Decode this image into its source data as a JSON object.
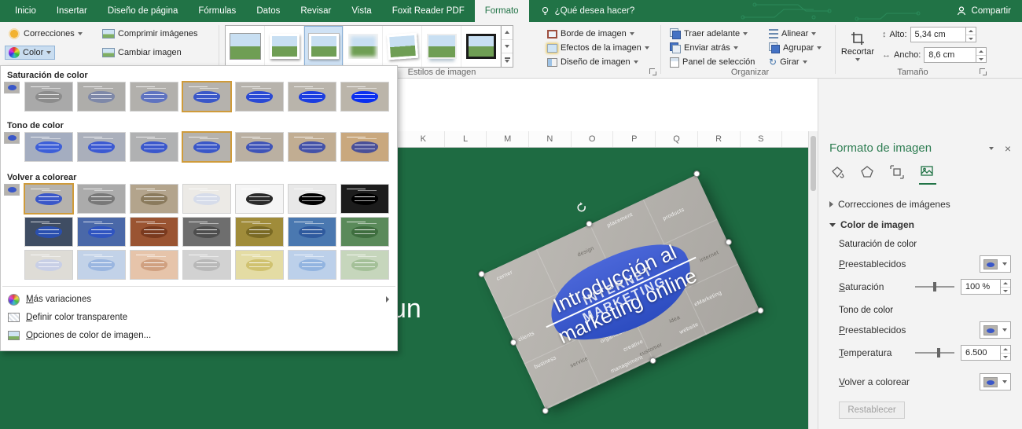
{
  "colors": {
    "excel_green": "#217346",
    "canvas_green": "#1e6b42",
    "pane_title": "#2e7d52",
    "picture_base": "#b5b2ad",
    "picture_accent": "#3a57c8",
    "selected_outline": "#cf9b3a",
    "gallery_sel_bg": "#cfe2f5",
    "gallery_sel_border": "#88b0d8"
  },
  "titlebar": {
    "tabs": [
      {
        "label": "Inicio"
      },
      {
        "label": "Insertar"
      },
      {
        "label": "Diseño de página"
      },
      {
        "label": "Fórmulas"
      },
      {
        "label": "Datos"
      },
      {
        "label": "Revisar"
      },
      {
        "label": "Vista"
      },
      {
        "label": "Foxit Reader PDF"
      },
      {
        "label": "Formato",
        "active": true
      }
    ],
    "search_label": "¿Qué desea hacer?",
    "share_label": "Compartir"
  },
  "ribbon": {
    "adjust": {
      "corrections_label": "Correcciones",
      "color_label": "Color",
      "compress_label": "Comprimir imágenes",
      "change_label": "Cambiar imagen"
    },
    "picture_styles": {
      "group_label": "Estilos de imagen",
      "items": [
        "marco-simple",
        "biselado-blanco",
        "rectangulo-sombreado",
        "bordes-suaves",
        "rectangulo-girado-blanco",
        "rectangulo-reflejado",
        "marco-negro"
      ],
      "selected_index": 2,
      "border_label": "Borde de imagen",
      "effects_label": "Efectos de la imagen",
      "layout_label": "Diseño de imagen"
    },
    "arrange": {
      "group_label": "Organizar",
      "bring_forward": "Traer adelante",
      "send_backward": "Enviar atrás",
      "selection_pane": "Panel de selección",
      "align": "Alinear",
      "group": "Agrupar",
      "rotate": "Girar"
    },
    "size": {
      "group_label": "Tamaño",
      "crop_label": "Recortar",
      "height_label": "Alto:",
      "height_value": "5,34 cm",
      "width_label": "Ancho:",
      "width_value": "8,6 cm"
    }
  },
  "color_menu": {
    "sections": {
      "saturation_title": "Saturación de color",
      "tone_title": "Tono de color",
      "recolor_title": "Volver a colorear"
    },
    "items": {
      "more_variations": "Más variaciones",
      "set_transparent": "Definir color transparente",
      "options": "Opciones de color de imagen..."
    },
    "saturation": [
      {
        "bg": "#a9a9a9",
        "accent": "#8c8c8c"
      },
      {
        "bg": "#aeadaa",
        "accent": "#7e88a8"
      },
      {
        "bg": "#b2b0ac",
        "accent": "#5f73c0"
      },
      {
        "bg": "#b5b2ad",
        "accent": "#3a57c8",
        "selected": true
      },
      {
        "bg": "#b7b3ac",
        "accent": "#2a49d4"
      },
      {
        "bg": "#b9b4ab",
        "accent": "#1b3de0"
      },
      {
        "bg": "#bbb5aa",
        "accent": "#0a2ff0"
      }
    ],
    "tone": [
      {
        "bg": "#a4adc0",
        "accent": "#3d5fd8"
      },
      {
        "bg": "#aaafbb",
        "accent": "#3c5ad2"
      },
      {
        "bg": "#b0b1b2",
        "accent": "#3b58cc"
      },
      {
        "bg": "#b5b2ad",
        "accent": "#3a57c8",
        "selected": true
      },
      {
        "bg": "#bab0a2",
        "accent": "#3f54b8"
      },
      {
        "bg": "#c1ad92",
        "accent": "#4452a8"
      },
      {
        "bg": "#c9a87e",
        "accent": "#4a5098"
      }
    ],
    "recolor": [
      [
        {
          "bg": "#b5b2ad",
          "accent": "#3a57c8",
          "selected": true
        },
        {
          "bg": "#ababab",
          "accent": "#787878"
        },
        {
          "bg": "#b3a48c",
          "accent": "#8a7a5c"
        },
        {
          "bg": "#eceae6",
          "accent": "#d6dcea"
        },
        {
          "bg": "#f5f5f5",
          "accent": "#2a2a2a"
        },
        {
          "bg": "#e8e8e8",
          "accent": "#000000"
        },
        {
          "bg": "#1c1c1c",
          "accent": "#000000"
        }
      ],
      [
        {
          "bg": "#3f4d63",
          "accent": "#2a4fae"
        },
        {
          "bg": "#4a68a8",
          "accent": "#2f54c0"
        },
        {
          "bg": "#9a5432",
          "accent": "#7a3a1e"
        },
        {
          "bg": "#6e6e6e",
          "accent": "#4e4e4e"
        },
        {
          "bg": "#a08c3a",
          "accent": "#7a6a24"
        },
        {
          "bg": "#4a78b0",
          "accent": "#2f5a9e"
        },
        {
          "bg": "#5a8a5a",
          "accent": "#3f6e3f"
        }
      ],
      [
        {
          "bg": "#dedcd6",
          "accent": "#c8cfe6"
        },
        {
          "bg": "#c2d2e8",
          "accent": "#9ab6e0"
        },
        {
          "bg": "#e6c4aa",
          "accent": "#d0a080"
        },
        {
          "bg": "#d2d2d2",
          "accent": "#b8b8b8"
        },
        {
          "bg": "#e4dca4",
          "accent": "#d0c270"
        },
        {
          "bg": "#bcd0ea",
          "accent": "#92b4e0"
        },
        {
          "bg": "#c6d6bc",
          "accent": "#a4c098"
        }
      ]
    ]
  },
  "sheet": {
    "columns": [
      "K",
      "L",
      "M",
      "N",
      "O",
      "P",
      "Q",
      "R",
      "S"
    ]
  },
  "canvas": {
    "fragment": "un",
    "image": {
      "title_line1": "Introducción al",
      "title_line2": "marketing online",
      "bg_word_top": "INTERNET",
      "bg_word_bottom": "MARKETING",
      "words": [
        "corner",
        "design",
        "placement",
        "products",
        "internet",
        "clients",
        "business",
        "service",
        "organization",
        "creative",
        "idea",
        "eMarketing",
        "website",
        "customer",
        "management"
      ]
    }
  },
  "pane": {
    "title": "Formato de imagen",
    "icons": [
      "relleno-linea",
      "efectos",
      "tamano-propiedades",
      "imagen"
    ],
    "sections": {
      "corrections": "Correcciones de imágenes",
      "color": "Color de imagen",
      "saturation_header": "Saturación de color",
      "presets_label": "Preestablecidos",
      "saturation_label": "Saturación",
      "saturation_value": "100 %",
      "tone_header": "Tono de color",
      "presets2_label": "Preestablecidos",
      "temperature_label": "Temperatura",
      "temperature_value": "6.500",
      "recolor_label": "Volver a colorear",
      "reset_label": "Restablecer"
    }
  }
}
